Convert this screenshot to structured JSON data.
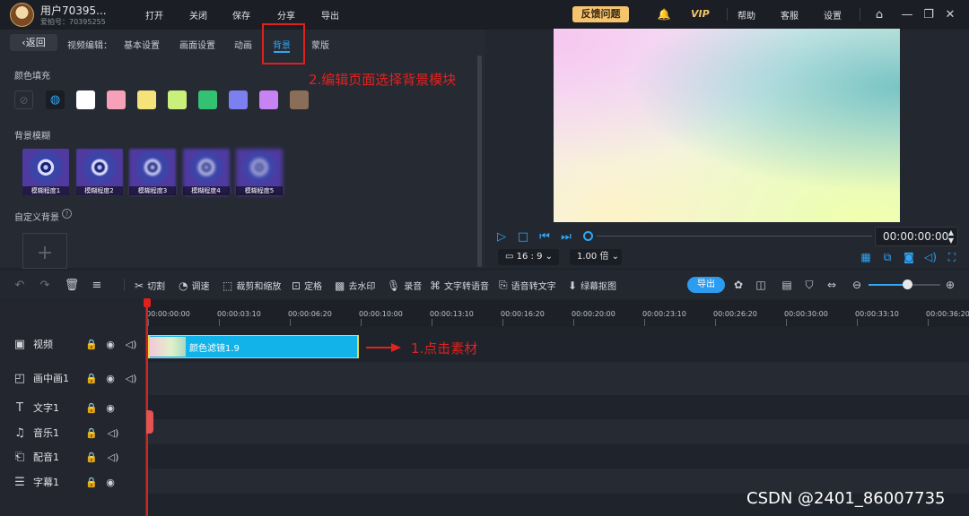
{
  "app": {
    "user_name": "用户70395...",
    "user_id": "爱拍号：70395255",
    "menu": [
      "打开",
      "关闭",
      "保存",
      "分享",
      "导出"
    ],
    "feedback": "反馈问题",
    "vip": "VIP",
    "right_menu": [
      "帮助",
      "客服",
      "设置"
    ]
  },
  "editor": {
    "back": "返回",
    "label": "视频编辑：",
    "tabs": [
      "基本设置",
      "画面设置",
      "动画",
      "背景",
      "蒙版"
    ],
    "active_tab": "背景",
    "color_fill_label": "颜色填充",
    "swatches": [
      "#ffffff",
      "#f7a1b8",
      "#f5e27a",
      "#c8f07a",
      "#34c272",
      "#7b7ff0",
      "#c782f4",
      "#8a6e58"
    ],
    "blur_label": "背景模糊",
    "blur_items": [
      "模糊程度1",
      "模糊程度2",
      "模糊程度3",
      "模糊程度4",
      "模糊程度5"
    ],
    "custom_bg_label": "自定义背景"
  },
  "preview": {
    "timecode": "00:00:00:00",
    "ratio": "16 : 9",
    "speed": "1.00 倍"
  },
  "toolbar": {
    "tools": [
      "切割",
      "调速",
      "裁剪和缩放",
      "定格",
      "去水印",
      "录音",
      "文字转语音",
      "语音转文字",
      "绿幕抠图"
    ],
    "export": "导出"
  },
  "timeline": {
    "ticks": [
      "00:00:00:00",
      "00:00:03:10",
      "00:00:06:20",
      "00:00:10:00",
      "00:00:13:10",
      "00:00:16:20",
      "00:00:20:00",
      "00:00:23:10",
      "00:00:26:20",
      "00:00:30:00",
      "00:00:33:10",
      "00:00:36:20"
    ],
    "tracks": [
      "视频",
      "画中画1",
      "文字1",
      "音乐1",
      "配音1",
      "字幕1"
    ],
    "clip_label": "颜色滤镜1.9",
    "zoom_level": 0.54
  },
  "annotations": {
    "step1": "1.点击素材",
    "step2": "2.编辑页面选择背景模块",
    "watermark": "CSDN @2401_86007735",
    "highlight_color": "#e0201c"
  }
}
